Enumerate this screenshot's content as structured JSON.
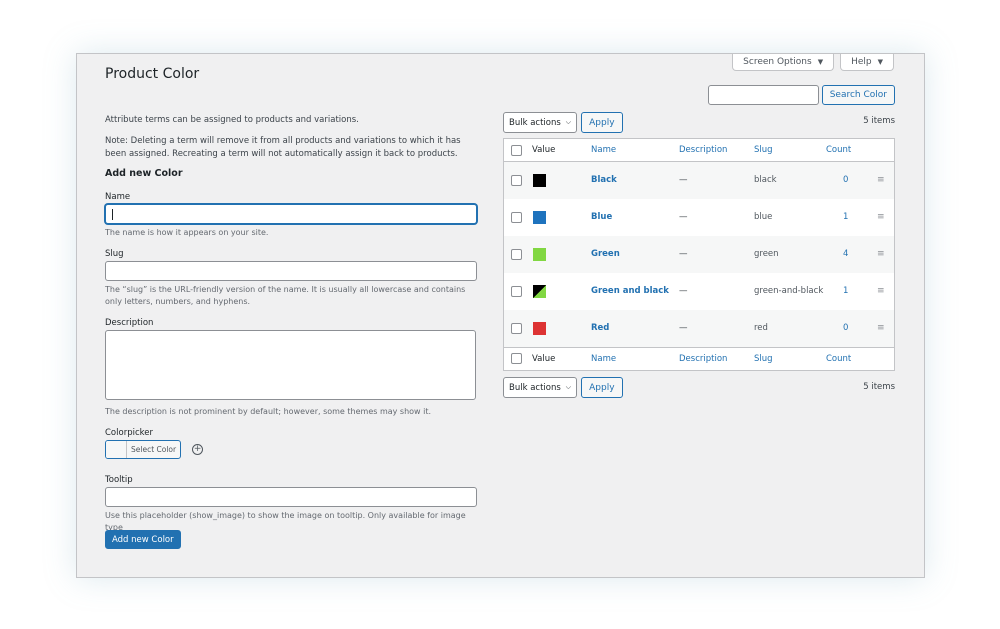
{
  "page": {
    "title": "Product Color"
  },
  "screen_tabs": {
    "screen_options": "Screen Options",
    "help": "Help"
  },
  "search": {
    "button": "Search Color",
    "value": ""
  },
  "intro": {
    "p1": "Attribute terms can be assigned to products and variations.",
    "p2": "Note: Deleting a term will remove it from all products and variations to which it has been assigned. Recreating a term will not automatically assign it back to products."
  },
  "form": {
    "title": "Add new Color",
    "name_label": "Name",
    "name_value": "",
    "name_desc": "The name is how it appears on your site.",
    "slug_label": "Slug",
    "slug_value": "",
    "slug_desc": "The “slug” is the URL-friendly version of the name. It is usually all lowercase and contains only letters, numbers, and hyphens.",
    "description_label": "Description",
    "description_desc": "The description is not prominent by default; however, some themes may show it.",
    "colorpicker_label": "Colorpicker",
    "colorpicker_button": "Select Color",
    "tooltip_label": "Tooltip",
    "tooltip_desc": "Use this placeholder (show_image) to show the image on tooltip. Only available for image type",
    "submit": "Add new Color"
  },
  "bulk": {
    "select": "Bulk actions",
    "apply": "Apply",
    "items": "5 items"
  },
  "table": {
    "headers": {
      "value": "Value",
      "name": "Name",
      "description": "Description",
      "slug": "Slug",
      "count": "Count"
    },
    "rows": [
      {
        "name": "Black",
        "description": "—",
        "slug": "black",
        "count": "0",
        "color": "#000000"
      },
      {
        "name": "Blue",
        "description": "—",
        "slug": "blue",
        "count": "1",
        "color": "#1e73be"
      },
      {
        "name": "Green",
        "description": "—",
        "slug": "green",
        "count": "4",
        "color": "#81d742"
      },
      {
        "name": "Green and black",
        "description": "—",
        "slug": "green-and-black",
        "count": "1",
        "color": "split:#000000/#81d742"
      },
      {
        "name": "Red",
        "description": "—",
        "slug": "red",
        "count": "0",
        "color": "#dd3333"
      }
    ]
  },
  "colors": {
    "accent": "#2271b1",
    "background": "#f0f0f1"
  }
}
